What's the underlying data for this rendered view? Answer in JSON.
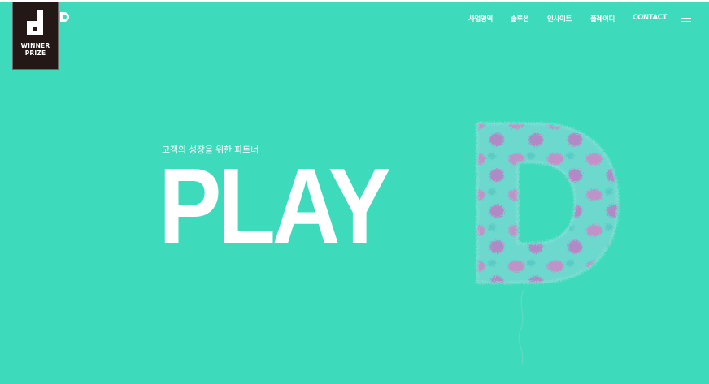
{
  "badge": {
    "line1": "WINNER",
    "line2": "PRIZE"
  },
  "logo": {
    "letter": "D"
  },
  "nav": {
    "items": [
      {
        "label": "사업영역"
      },
      {
        "label": "솔루션"
      },
      {
        "label": "인사이트"
      },
      {
        "label": "플레이디"
      },
      {
        "label": "CONTACT"
      }
    ]
  },
  "hero": {
    "subtitle": "고객의 성장을 위한 파트너",
    "headline": "PLAY"
  },
  "colors": {
    "background": "#3ddbbb",
    "text": "#ffffff",
    "badge_bg": "#231815",
    "fur_teal": "#6fd8cf",
    "fur_pink": "#c98fc8"
  },
  "icons": {
    "menu": "hamburger-icon",
    "badge": "winner-prize-logo",
    "hero_graphic": "fur-letter-d"
  }
}
